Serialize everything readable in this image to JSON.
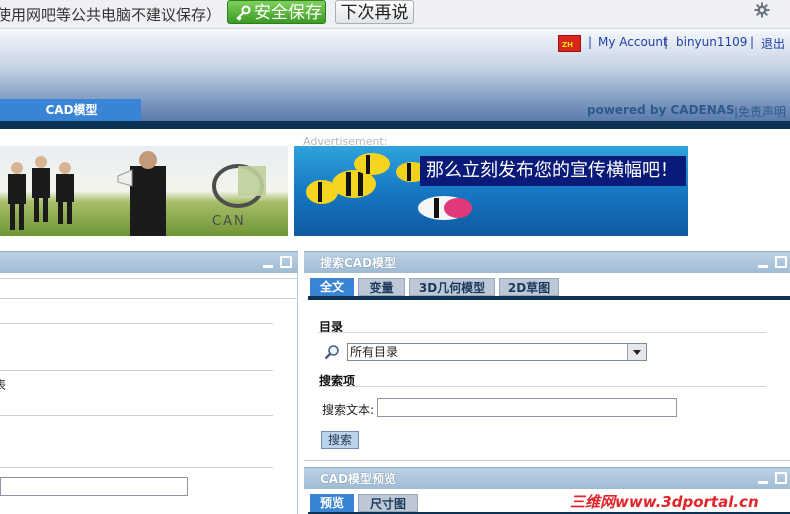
{
  "topbar": {
    "message": "使用网吧等公共电脑不建议保存）",
    "save_label": "安全保存",
    "later_label": "下次再说",
    "gear_icon": "gear-icon",
    "save_icon": "key-icon"
  },
  "header": {
    "flag_text": "ZH",
    "my_account": "My Account",
    "username": "binyun1109",
    "logout": "退出",
    "separator": "|",
    "tab_label": "CAD模型",
    "powered": "powered by CADENAS",
    "disclaimer": "|免责声明"
  },
  "banners": {
    "ad_label": "Advertisement:",
    "cad_logo_text": "CAN",
    "promo_text": "那么立刻发布您的宣传横幅吧！"
  },
  "search_panel": {
    "title": "搜索CAD模型",
    "tabs": [
      {
        "label": "全文",
        "active": true
      },
      {
        "label": "变量",
        "active": false
      },
      {
        "label": "3D几何模型",
        "active": false
      },
      {
        "label": "2D草图",
        "active": false
      }
    ],
    "catalog_label": "目录",
    "catalog_value": "所有目录",
    "items_label": "搜索项",
    "search_text_label": "搜索文本:",
    "search_text_value": "",
    "search_button": "搜索"
  },
  "preview_panel": {
    "title": "CAD模型预览",
    "tabs": [
      {
        "label": "预览",
        "active": true
      },
      {
        "label": "尺寸图",
        "active": false
      }
    ]
  },
  "left_panel": {
    "partial_text": "表",
    "input_value": ""
  },
  "watermark": "三维网www.3dportal.cn",
  "colors": {
    "accent_blue": "#3a84d6",
    "nav_dark": "#0d3354",
    "save_green": "#3c9a24",
    "watermark_red": "#e3242b"
  }
}
